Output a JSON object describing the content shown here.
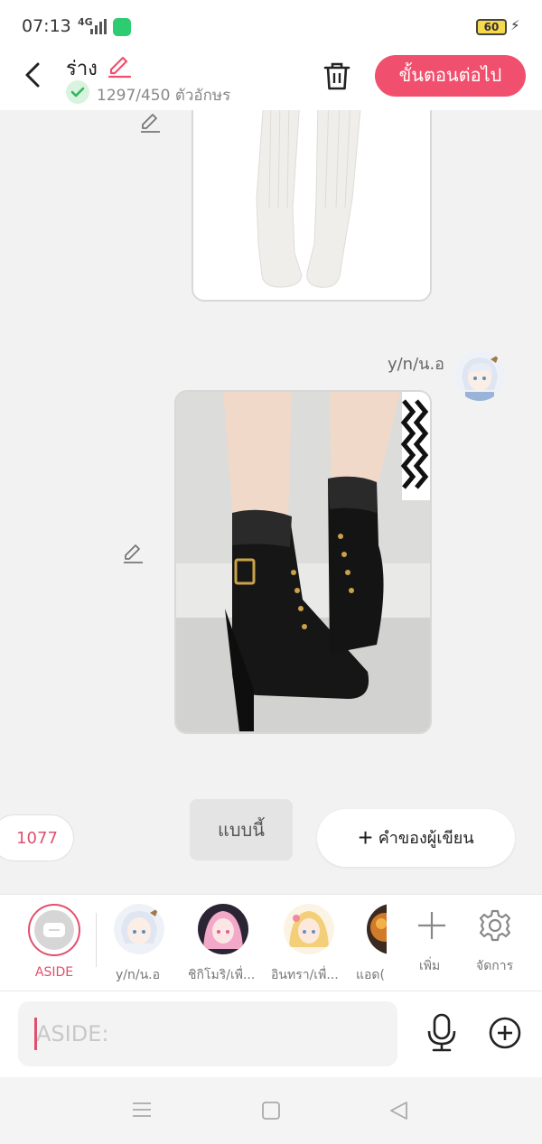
{
  "status_bar": {
    "time": "07:13",
    "network": "4G",
    "battery": "60"
  },
  "header": {
    "title": "ร่าง",
    "char_count": "1297/450 ตัวอักษร",
    "next_button": "ขั้นตอนต่อไป"
  },
  "chat": {
    "sender_name": "y/n/น.อ",
    "count_badge": "1077",
    "chip_text": "แบบนี้",
    "author_note_button": "คำของผู้เขียน"
  },
  "character_bar": {
    "aside_label": "ASIDE",
    "characters": [
      {
        "name": "y/n/น.อ"
      },
      {
        "name": "ชิกิโมริ/เพื่..."
      },
      {
        "name": "อินทรา/เพื่..."
      },
      {
        "name": "แอด("
      }
    ],
    "add_label": "เพิ่ม",
    "manage_label": "จัดการ"
  },
  "input": {
    "placeholder": "ASIDE:"
  },
  "colors": {
    "accent": "#f0506e",
    "background": "#f2f2f2"
  }
}
